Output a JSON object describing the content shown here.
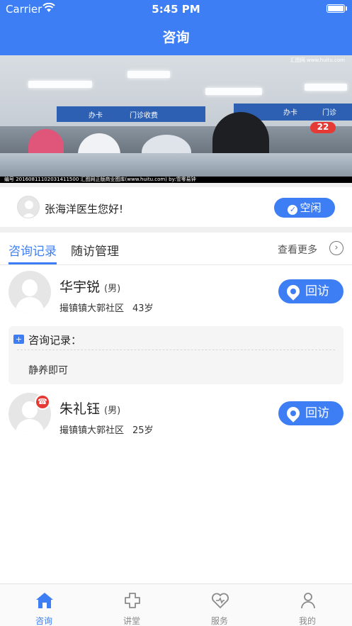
{
  "status_bar": {
    "carrier": "Carrier",
    "time": "5:45 PM"
  },
  "nav": {
    "title": "咨询"
  },
  "banner": {
    "caption": "编号 20160811102031411500  汇图网正版商业图库(www.huitu.com)  by:雪零易钟",
    "watermark": "汇图网 www.huitu.com",
    "sign_left_1": "办卡",
    "sign_left_2": "门诊收费",
    "sign_right_1": "办卡",
    "sign_right_2": "门诊",
    "number": "22"
  },
  "greeting": {
    "text": "张海洋医生您好!",
    "status_label": "空闲"
  },
  "tabs": {
    "active": "咨询记录",
    "inactive": "随访管理",
    "see_more": "查看更多"
  },
  "records": [
    {
      "name": "华宇锐",
      "gender": "(男)",
      "address": "撮镇镇大郭社区",
      "age": "43岁",
      "button": "回访"
    },
    {
      "name": "朱礼钰",
      "gender": "(男)",
      "address": "撮镇镇大郭社区",
      "age": "25岁",
      "button": "回访"
    }
  ],
  "note": {
    "title": "咨询记录：",
    "body": "静养即可"
  },
  "tabbar": [
    {
      "label": "咨询",
      "icon": "home-icon"
    },
    {
      "label": "讲堂",
      "icon": "lecture-icon"
    },
    {
      "label": "服务",
      "icon": "service-icon"
    },
    {
      "label": "我的",
      "icon": "profile-icon"
    }
  ],
  "colors": {
    "accent": "#3d7ef5",
    "alert": "#e53935"
  }
}
